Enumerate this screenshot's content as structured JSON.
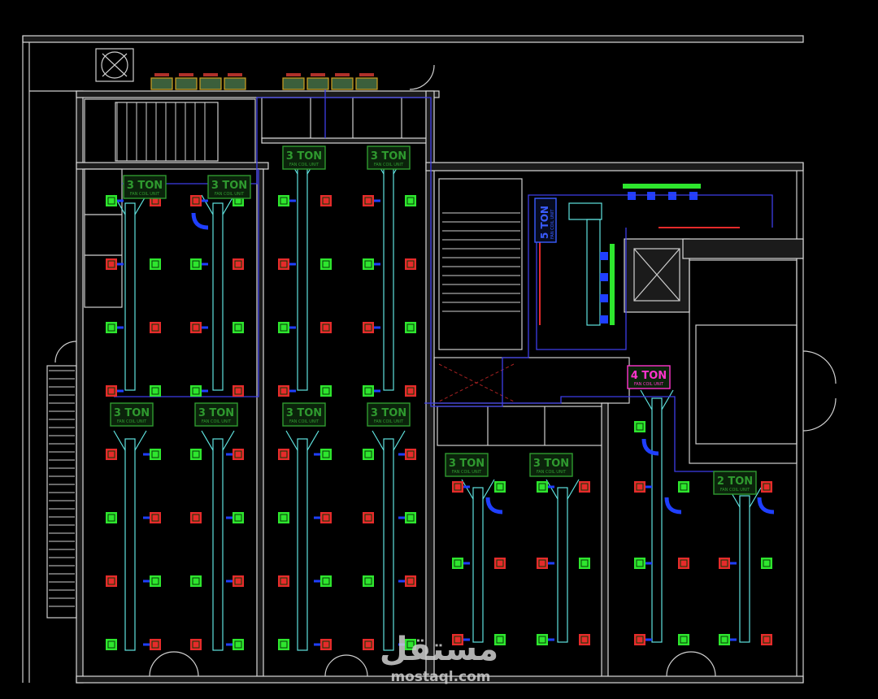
{
  "drawing": {
    "background": "#000000",
    "colors": {
      "supply_diffuser": "#2ee62e",
      "return_grille": "#e62b2b",
      "duct": "#5fe3df",
      "pipe": "#3e3ee8",
      "flex_connector": "#1f3fff",
      "wall": "#cfcfcf",
      "fcu_label": "#2f9a2f",
      "fcu_label_4ton": "#ff33cc",
      "fcu_label_5ton": "#3a5cff"
    },
    "units": [
      {
        "capacity": "3 TON",
        "sub": "FAN COIL UNIT",
        "color": "#2f9a2f"
      },
      {
        "capacity": "3 TON",
        "sub": "FAN COIL UNIT",
        "color": "#2f9a2f"
      },
      {
        "capacity": "3 TON",
        "sub": "FAN COIL UNIT",
        "color": "#2f9a2f"
      },
      {
        "capacity": "3 TON",
        "sub": "FAN COIL UNIT",
        "color": "#2f9a2f"
      },
      {
        "capacity": "3 TON",
        "sub": "FAN COIL UNIT",
        "color": "#2f9a2f"
      },
      {
        "capacity": "3 TON",
        "sub": "FAN COIL UNIT",
        "color": "#2f9a2f"
      },
      {
        "capacity": "3 TON",
        "sub": "FAN COIL UNIT",
        "color": "#2f9a2f"
      },
      {
        "capacity": "3 TON",
        "sub": "FAN COIL UNIT",
        "color": "#2f9a2f"
      },
      {
        "capacity": "3 TON",
        "sub": "FAN COIL UNIT",
        "color": "#2f9a2f"
      },
      {
        "capacity": "3 TON",
        "sub": "FAN COIL UNIT",
        "color": "#2f9a2f"
      },
      {
        "capacity": "4 TON",
        "sub": "FAN COIL UNIT",
        "color": "#ff33cc"
      },
      {
        "capacity": "2 TON",
        "sub": "FAN COIL UNIT",
        "color": "#2f9a2f"
      },
      {
        "capacity": "5 TON",
        "sub": "FAN COIL UNIT",
        "color": "#3a5cff"
      }
    ],
    "watermark": {
      "arabic": "مستقل",
      "latin": "mostaql.com"
    }
  }
}
